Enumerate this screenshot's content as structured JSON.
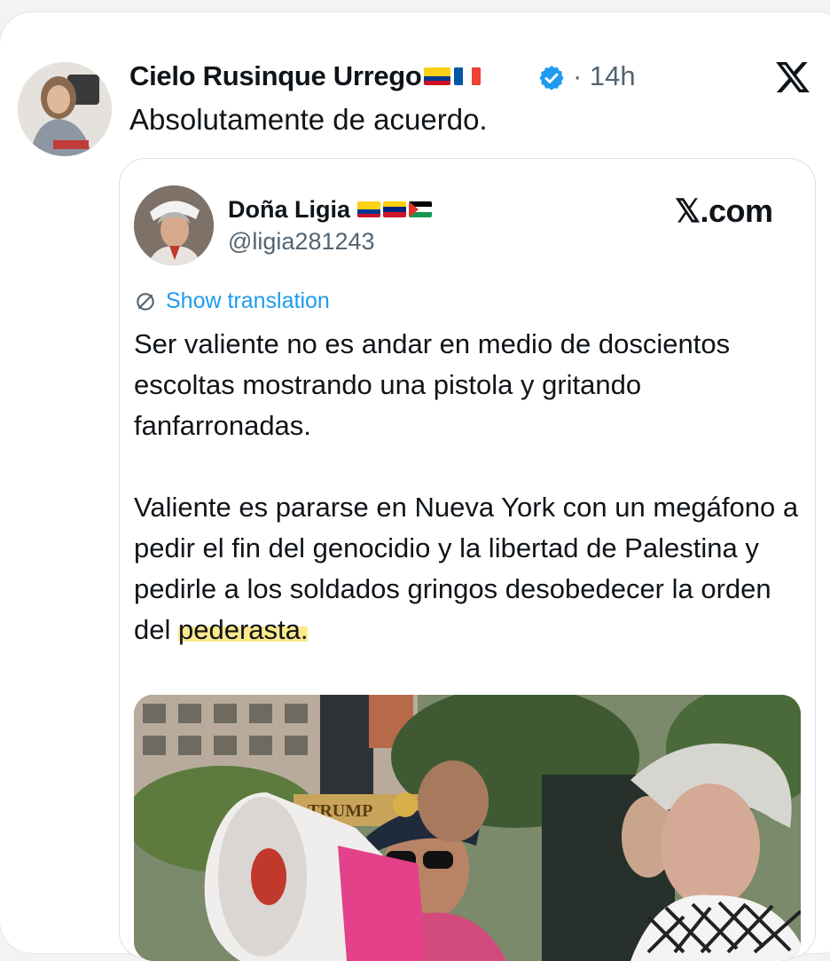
{
  "tweet": {
    "author_name": "Cielo Rusinque Urrego",
    "time": "· 14h",
    "text": "Absolutamente de acuerdo."
  },
  "icons": {
    "author_flags": [
      "colombia-flag-icon",
      "france-flag-icon"
    ],
    "verified": "verified-badge-icon",
    "brand": "x-logo-icon",
    "quoted_flags": [
      "colombia-flag-icon",
      "venezuela-flag-icon",
      "palestine-flag-icon"
    ],
    "translate": "translate-icon"
  },
  "colors": {
    "accent": "#1d9bf0",
    "highlight": "#fbe98b",
    "secondary_text": "#536471"
  },
  "quoted": {
    "author_name": "Doña Ligia",
    "handle": "@ligia281243",
    "source": "𝕏.com",
    "show_translation": "Show translation",
    "paragraph1": "Ser valiente no es andar en medio de doscientos escoltas mostrando una pistola y gritando fanfarronadas.",
    "paragraph2_main": "Valiente es pararse en Nueva York con un megáfono a pedir el fin del genocidio y la libertad de Palestina y pedirle a los soldados gringos desobedecer la orden del ",
    "paragraph2_highlight": "pederasta."
  },
  "photo": {
    "sign_text": "TRUMP"
  }
}
